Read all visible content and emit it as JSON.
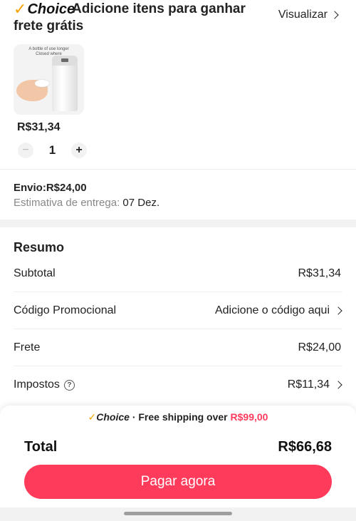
{
  "header": {
    "badge": "Choice",
    "title": "Adicione itens para ganhar frete grátis",
    "view_label": "Visualizar"
  },
  "product": {
    "image_text_1": "A bottle of use longer",
    "image_text_2": "Closed where",
    "price": "R$31,34",
    "quantity": "1",
    "minus": "−",
    "plus": "+"
  },
  "shipping": {
    "label": "Envio:R$24,00",
    "estimate_label": "Estimativa de entrega:",
    "estimate_value": "07 Dez."
  },
  "summary": {
    "title": "Resumo",
    "rows": [
      {
        "label": "Subtotal",
        "value": "R$31,34"
      },
      {
        "label": "Código Promocional",
        "value": "Adicione o código aqui"
      },
      {
        "label": "Frete",
        "value": "R$24,00"
      },
      {
        "label": "Impostos",
        "value": "R$11,34"
      }
    ]
  },
  "footer": {
    "badge": "Choice",
    "promo_text": "· Free shipping over",
    "promo_amount": "R$99,00",
    "total_label": "Total",
    "total_value": "R$66,68",
    "pay_button": "Pagar agora"
  },
  "colors": {
    "accent": "#ff3b5c",
    "choice_check": "#f5a300"
  }
}
